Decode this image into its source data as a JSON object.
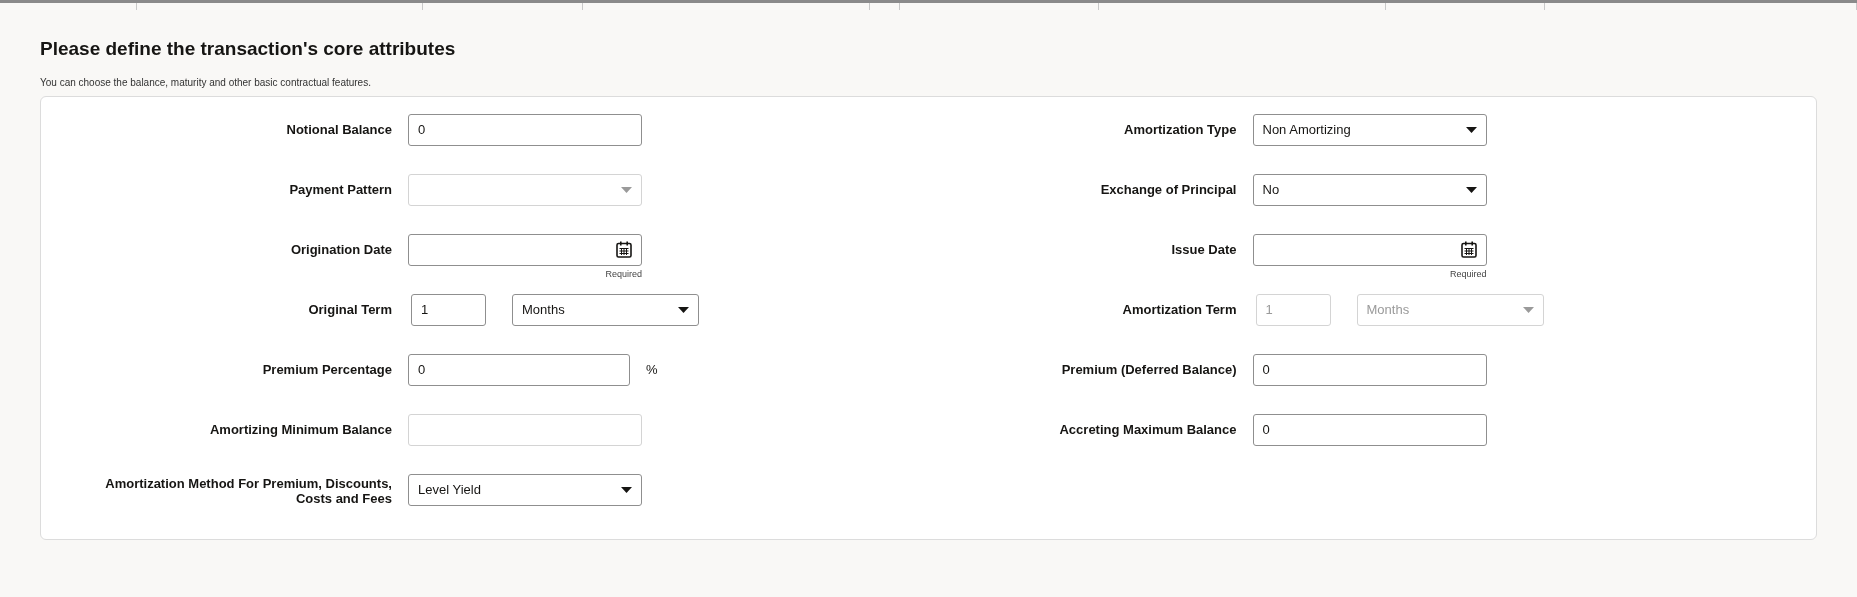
{
  "header": {
    "title": "Please define the transaction's core attributes",
    "subtitle": "You can choose the balance, maturity and other basic contractual features."
  },
  "columns": [
    [
      {
        "label": "Notional Balance",
        "kind": "text",
        "value": "0",
        "disabled": false
      },
      {
        "label": "Payment Pattern",
        "kind": "select",
        "disabled": true
      },
      {
        "label": "Origination Date",
        "kind": "date",
        "disabled": false,
        "hint": "Required"
      },
      {
        "label": "Original Term",
        "kind": "term",
        "number": "1",
        "unit": "Months",
        "disabled": false
      },
      {
        "label": "Premium Percentage",
        "kind": "text",
        "value": "0",
        "suffix": "%",
        "disabled": false
      },
      {
        "label": "Amortizing Minimum Balance",
        "kind": "text",
        "disabled": true
      },
      {
        "label": "Amortization Method For Premium, Discounts, Costs and Fees",
        "kind": "select",
        "value": "Level Yield",
        "disabled": false
      }
    ],
    [
      {
        "label": "Amortization Type",
        "kind": "select",
        "value": "Non Amortizing",
        "disabled": false
      },
      {
        "label": "Exchange of Principal",
        "kind": "select",
        "value": "No",
        "disabled": false
      },
      {
        "label": "Issue Date",
        "kind": "date",
        "disabled": false,
        "hint": "Required"
      },
      {
        "label": "Amortization Term",
        "kind": "term",
        "number": "1",
        "unit": "Months",
        "disabled": true
      },
      {
        "label": "Premium (Deferred Balance)",
        "kind": "text",
        "value": "0",
        "disabled": false
      },
      {
        "label": "Accreting Maximum Balance",
        "kind": "text",
        "value": "0",
        "disabled": false
      }
    ]
  ]
}
